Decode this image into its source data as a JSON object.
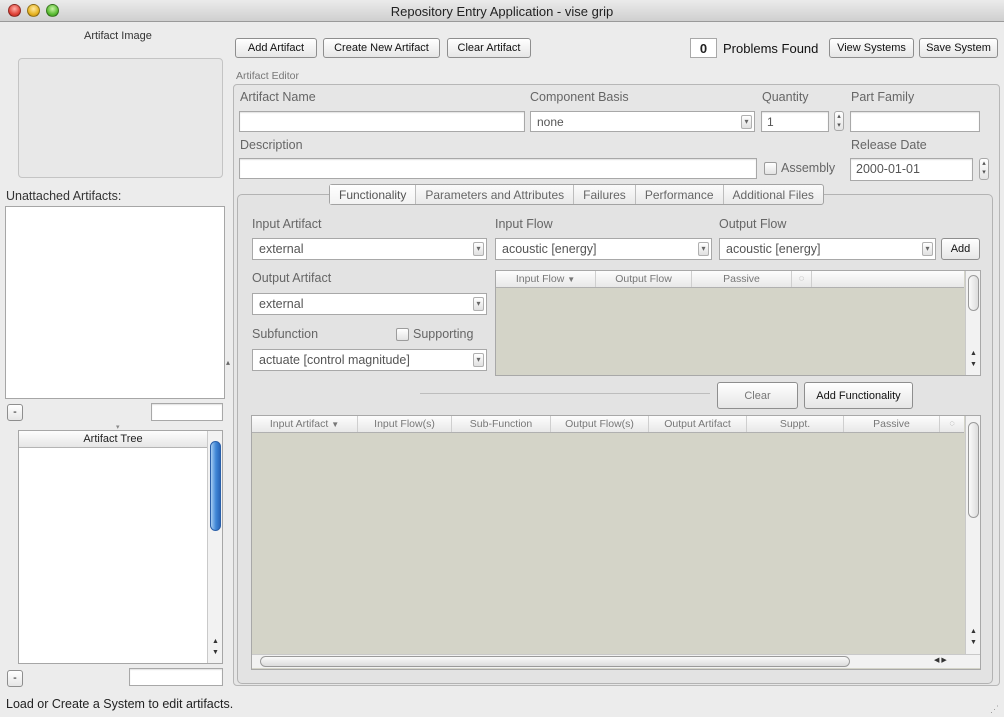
{
  "window": {
    "title": "Repository Entry Application - vise grip"
  },
  "left": {
    "artifact_image_label": "Artifact Image",
    "unattached_label": "Unattached Artifacts:",
    "remove_unattached": "-",
    "artifact_tree_header": "Artifact Tree",
    "remove_tree": "-"
  },
  "toolbar": {
    "add_artifact": "Add Artifact",
    "create_new_artifact": "Create New Artifact",
    "clear_artifact": "Clear Artifact",
    "problems_count": "0",
    "problems_label": "Problems Found",
    "view_systems": "View Systems",
    "save_system": "Save System"
  },
  "editor": {
    "group_label": "Artifact Editor",
    "artifact_name_label": "Artifact Name",
    "artifact_name_value": "",
    "component_basis_label": "Component Basis",
    "component_basis_value": "none",
    "quantity_label": "Quantity",
    "quantity_value": "1",
    "part_family_label": "Part Family",
    "part_family_value": "",
    "description_label": "Description",
    "description_value": "",
    "assembly_label": "Assembly",
    "release_date_label": "Release Date",
    "release_date_value": "2000-01-01"
  },
  "tabs": [
    "Functionality",
    "Parameters and Attributes",
    "Failures",
    "Performance",
    "Additional Files"
  ],
  "functionality": {
    "input_artifact_label": "Input Artifact",
    "input_artifact_value": "external",
    "input_flow_label": "Input Flow",
    "input_flow_value": "acoustic [energy]",
    "output_flow_label": "Output Flow",
    "output_flow_value": "acoustic [energy]",
    "add_button": "Add",
    "output_artifact_label": "Output Artifact",
    "output_artifact_value": "external",
    "subfunction_label": "Subfunction",
    "supporting_label": "Supporting",
    "subfunction_value": "actuate [control magnitude]",
    "flow_table_columns": [
      "Input Flow",
      "Output Flow",
      "Passive"
    ],
    "clear_button": "Clear",
    "add_functionality_button": "Add Functionality",
    "main_table_columns": [
      "Input Artifact",
      "Input Flow(s)",
      "Sub-Function",
      "Output Flow(s)",
      "Output Artifact",
      "Suppt.",
      "Passive"
    ]
  },
  "status": {
    "message": "Load or Create a System to edit artifacts."
  }
}
